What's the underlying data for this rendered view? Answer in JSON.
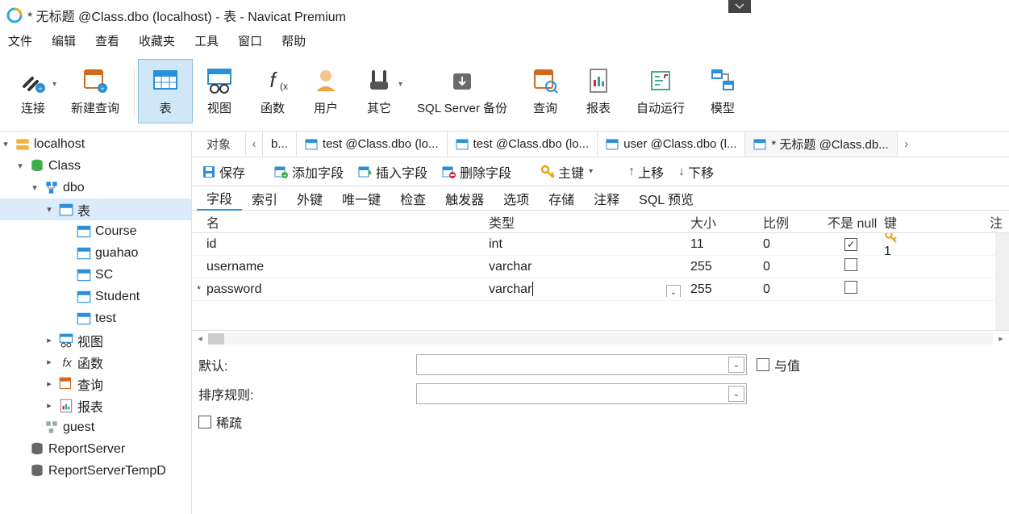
{
  "window": {
    "title": "* 无标题 @Class.dbo (localhost) - 表 - Navicat Premium"
  },
  "menu": {
    "file": "文件",
    "edit": "编辑",
    "view": "查看",
    "favorites": "收藏夹",
    "tools": "工具",
    "window": "窗口",
    "help": "帮助"
  },
  "toolbar": {
    "connect": "连接",
    "new_query": "新建查询",
    "table": "表",
    "view": "视图",
    "function": "函数",
    "user": "用户",
    "other": "其它",
    "backup": "SQL Server 备份",
    "query": "查询",
    "report": "报表",
    "autorun": "自动运行",
    "model": "模型"
  },
  "tree": {
    "root": "localhost",
    "db": "Class",
    "schema": "dbo",
    "tables_group": "表",
    "tables": [
      "Course",
      "guahao",
      "SC",
      "Student",
      "test"
    ],
    "views_group": "视图",
    "functions_group": "函数",
    "queries_group": "查询",
    "reports_group": "报表",
    "guest": "guest",
    "rs": "ReportServer",
    "rst": "ReportServerTempD"
  },
  "tabs": {
    "objects": "对象",
    "t0": "b...",
    "t1": "test @Class.dbo (lo...",
    "t2": "test @Class.dbo (lo...",
    "t3": "user @Class.dbo (l...",
    "t4": "* 无标题 @Class.db..."
  },
  "designer_toolbar": {
    "save": "保存",
    "add_field": "添加字段",
    "insert_field": "插入字段",
    "delete_field": "删除字段",
    "primary_key": "主键",
    "move_up": "上移",
    "move_down": "下移"
  },
  "subtabs": {
    "fields": "字段",
    "indexes": "索引",
    "foreign_keys": "外键",
    "uniques": "唯一键",
    "checks": "检查",
    "triggers": "触发器",
    "options": "选项",
    "storage": "存储",
    "comment": "注释",
    "sql_preview": "SQL 预览"
  },
  "grid": {
    "headers": {
      "name": "名",
      "type": "类型",
      "size": "大小",
      "scale": "比例",
      "not_null": "不是 null",
      "key": "键",
      "comment_head": "注"
    },
    "rows": [
      {
        "marker": "",
        "name": "id",
        "type": "int",
        "size": "11",
        "scale": "0",
        "not_null": true,
        "key": "1"
      },
      {
        "marker": "",
        "name": "username",
        "type": "varchar",
        "size": "255",
        "scale": "0",
        "not_null": false,
        "key": ""
      },
      {
        "marker": "*",
        "name": "password",
        "type": "varchar",
        "size": "255",
        "scale": "0",
        "not_null": false,
        "key": ""
      }
    ]
  },
  "props": {
    "default_label": "默认:",
    "collation_label": "排序规则:",
    "sparse_label": "稀疏",
    "with_value_label": "与值"
  }
}
